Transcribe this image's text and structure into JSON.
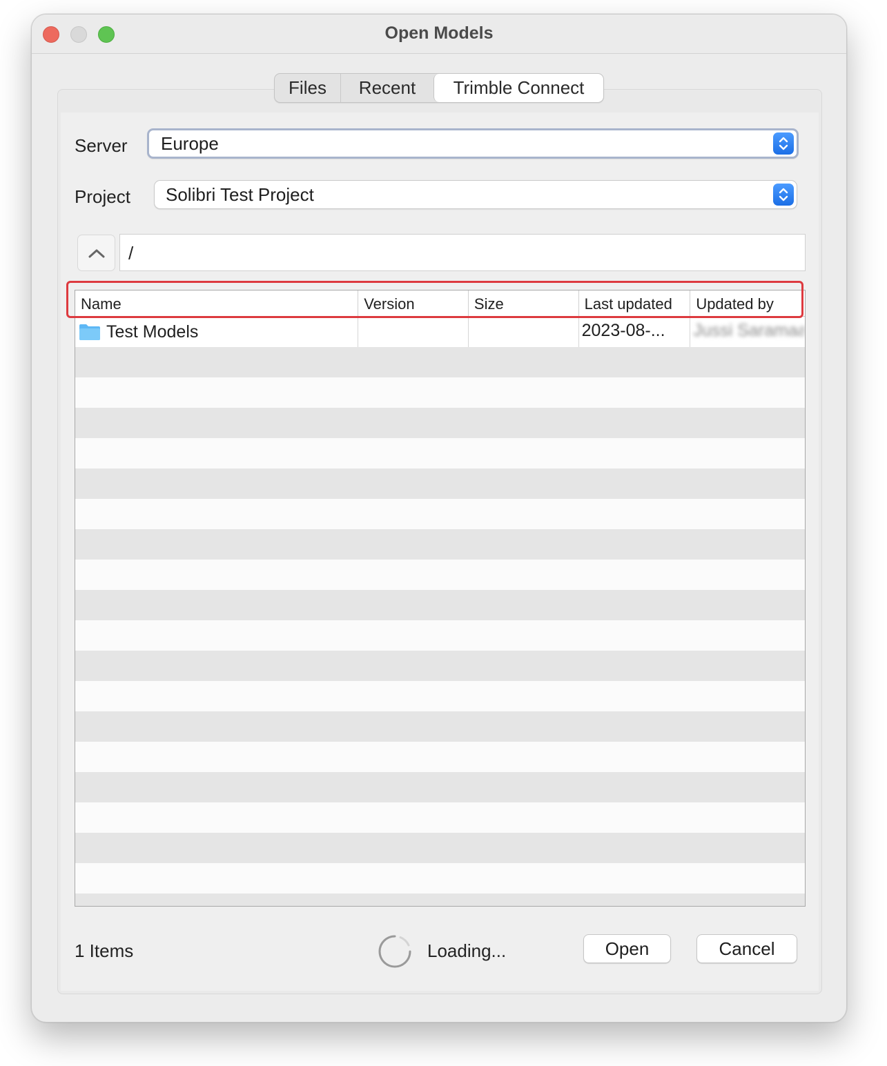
{
  "window": {
    "title": "Open Models"
  },
  "tabs": [
    {
      "label": "Files",
      "active": false
    },
    {
      "label": "Recent",
      "active": false
    },
    {
      "label": "Trimble Connect",
      "active": true
    }
  ],
  "server": {
    "label": "Server",
    "value": "Europe"
  },
  "project": {
    "label": "Project",
    "value": "Solibri Test Project"
  },
  "path": {
    "value": "/"
  },
  "table": {
    "columns": [
      "Name",
      "Version",
      "Size",
      "Last updated",
      "Updated by"
    ],
    "rows": [
      {
        "name": "Test Models",
        "version": "",
        "size": "",
        "last_updated": "2023-08-...",
        "updated_by": "Jussi Saramaa"
      }
    ]
  },
  "footer": {
    "items_count": "1 Items",
    "status": "Loading...",
    "open_label": "Open",
    "cancel_label": "Cancel"
  },
  "colors": {
    "highlight": "#dd3a3f",
    "stepper": "#1c6fe6",
    "folder": "#5eb8f5"
  },
  "icons": [
    "chevron-up-icon",
    "up-down-arrows-icon",
    "folder-icon",
    "spinner-icon"
  ]
}
